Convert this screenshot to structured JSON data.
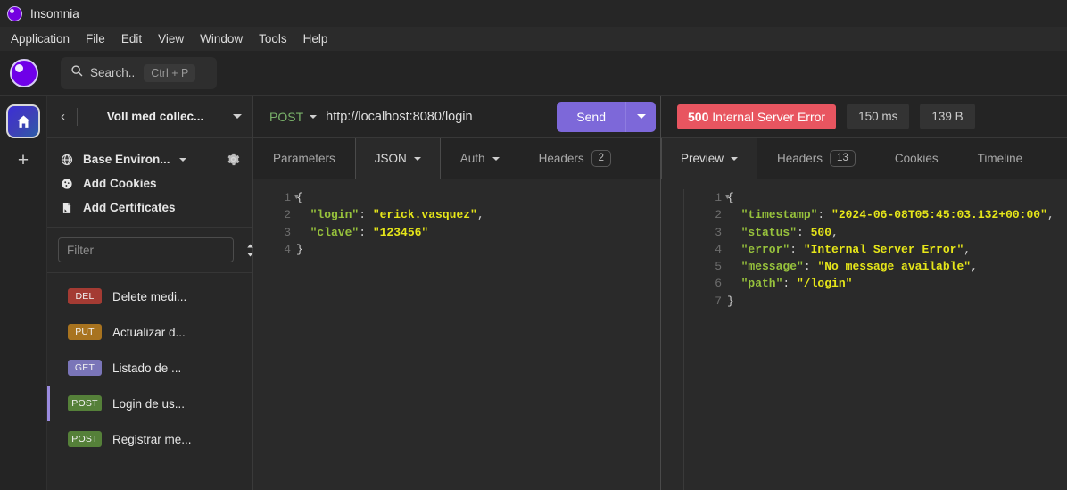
{
  "window": {
    "app_name": "Insomnia",
    "logo_icon": "insomnia-logo-icon"
  },
  "menubar": {
    "items": [
      "Application",
      "File",
      "Edit",
      "View",
      "Window",
      "Tools",
      "Help"
    ]
  },
  "search": {
    "icon": "search-icon",
    "label": "Search..",
    "shortcut": "Ctrl + P"
  },
  "rail": {
    "home_icon": "home-icon",
    "add_icon": "plus-icon"
  },
  "sidebar": {
    "back_icon": "chevron-left-icon",
    "collection_title": "Voll med collec...",
    "collection_caret": "chevron-down-icon",
    "environment": {
      "icon": "globe-icon",
      "label": "Base Environ...",
      "caret": "chevron-down-icon",
      "settings_icon": "gear-icon"
    },
    "cookies": {
      "icon": "cookie-icon",
      "label": "Add Cookies"
    },
    "certificates": {
      "icon": "certificate-icon",
      "label": "Add Certificates"
    },
    "filter": {
      "placeholder": "Filter",
      "value": "",
      "sort_icon": "sort-updown-icon",
      "add_icon": "plus-circle-icon"
    },
    "requests": [
      {
        "method": "DEL",
        "name": "Delete medi...",
        "color": "#a43b33",
        "active": false
      },
      {
        "method": "PUT",
        "name": "Actualizar d...",
        "color": "#a8731f",
        "active": false
      },
      {
        "method": "GET",
        "name": "Listado de ...",
        "color": "#7a75b8",
        "active": false
      },
      {
        "method": "POST",
        "name": "Login de us...",
        "color": "#558039",
        "active": true
      },
      {
        "method": "POST",
        "name": "Registrar me...",
        "color": "#558039",
        "active": false
      }
    ],
    "active_indicator_color": "#9a8bdf"
  },
  "request": {
    "method": "POST",
    "method_caret": "chevron-down-icon",
    "url": "http://localhost:8080/login",
    "send_label": "Send",
    "send_caret": "chevron-down-icon",
    "send_color": "#7d68d9",
    "tabs": [
      {
        "label": "Parameters",
        "active": false,
        "caret": false,
        "badge": null
      },
      {
        "label": "JSON",
        "active": true,
        "caret": true,
        "badge": null
      },
      {
        "label": "Auth",
        "active": false,
        "caret": true,
        "badge": null
      },
      {
        "label": "Headers",
        "active": false,
        "caret": false,
        "badge": "2"
      }
    ],
    "body_lines": [
      {
        "n": "1",
        "fold": true,
        "tokens": [
          {
            "t": "punc",
            "v": "{"
          }
        ]
      },
      {
        "n": "2",
        "fold": false,
        "tokens": [
          {
            "t": "key",
            "v": "  \"login\""
          },
          {
            "t": "punc",
            "v": ": "
          },
          {
            "t": "str",
            "v": "\"erick.vasquez\""
          },
          {
            "t": "punc",
            "v": ","
          }
        ]
      },
      {
        "n": "3",
        "fold": false,
        "tokens": [
          {
            "t": "key",
            "v": "  \"clave\""
          },
          {
            "t": "punc",
            "v": ": "
          },
          {
            "t": "str",
            "v": "\"123456\""
          }
        ]
      },
      {
        "n": "4",
        "fold": false,
        "tokens": [
          {
            "t": "punc",
            "v": "}"
          }
        ]
      }
    ]
  },
  "response": {
    "status_code": "500",
    "status_text": "Internal Server Error",
    "status_color": "#e85560",
    "time": "150 ms",
    "size": "139 B",
    "tabs": [
      {
        "label": "Preview",
        "active": true,
        "caret": true,
        "badge": null
      },
      {
        "label": "Headers",
        "active": false,
        "caret": false,
        "badge": "13"
      },
      {
        "label": "Cookies",
        "active": false,
        "caret": false,
        "badge": null
      },
      {
        "label": "Timeline",
        "active": false,
        "caret": false,
        "badge": null
      }
    ],
    "body_lines": [
      {
        "n": "1",
        "fold": true,
        "tokens": [
          {
            "t": "punc",
            "v": "{"
          }
        ]
      },
      {
        "n": "2",
        "fold": false,
        "tokens": [
          {
            "t": "key",
            "v": "  \"timestamp\""
          },
          {
            "t": "punc",
            "v": ": "
          },
          {
            "t": "str",
            "v": "\"2024-06-08T05:45:03.132+00:00\""
          },
          {
            "t": "punc",
            "v": ","
          }
        ]
      },
      {
        "n": "3",
        "fold": false,
        "tokens": [
          {
            "t": "key",
            "v": "  \"status\""
          },
          {
            "t": "punc",
            "v": ": "
          },
          {
            "t": "num",
            "v": "500"
          },
          {
            "t": "punc",
            "v": ","
          }
        ]
      },
      {
        "n": "4",
        "fold": false,
        "tokens": [
          {
            "t": "key",
            "v": "  \"error\""
          },
          {
            "t": "punc",
            "v": ": "
          },
          {
            "t": "str",
            "v": "\"Internal Server Error\""
          },
          {
            "t": "punc",
            "v": ","
          }
        ]
      },
      {
        "n": "5",
        "fold": false,
        "tokens": [
          {
            "t": "key",
            "v": "  \"message\""
          },
          {
            "t": "punc",
            "v": ": "
          },
          {
            "t": "str",
            "v": "\"No message available\""
          },
          {
            "t": "punc",
            "v": ","
          }
        ]
      },
      {
        "n": "6",
        "fold": false,
        "tokens": [
          {
            "t": "key",
            "v": "  \"path\""
          },
          {
            "t": "punc",
            "v": ": "
          },
          {
            "t": "str",
            "v": "\"/login\""
          }
        ]
      },
      {
        "n": "7",
        "fold": false,
        "tokens": [
          {
            "t": "punc",
            "v": "}"
          }
        ]
      }
    ]
  }
}
